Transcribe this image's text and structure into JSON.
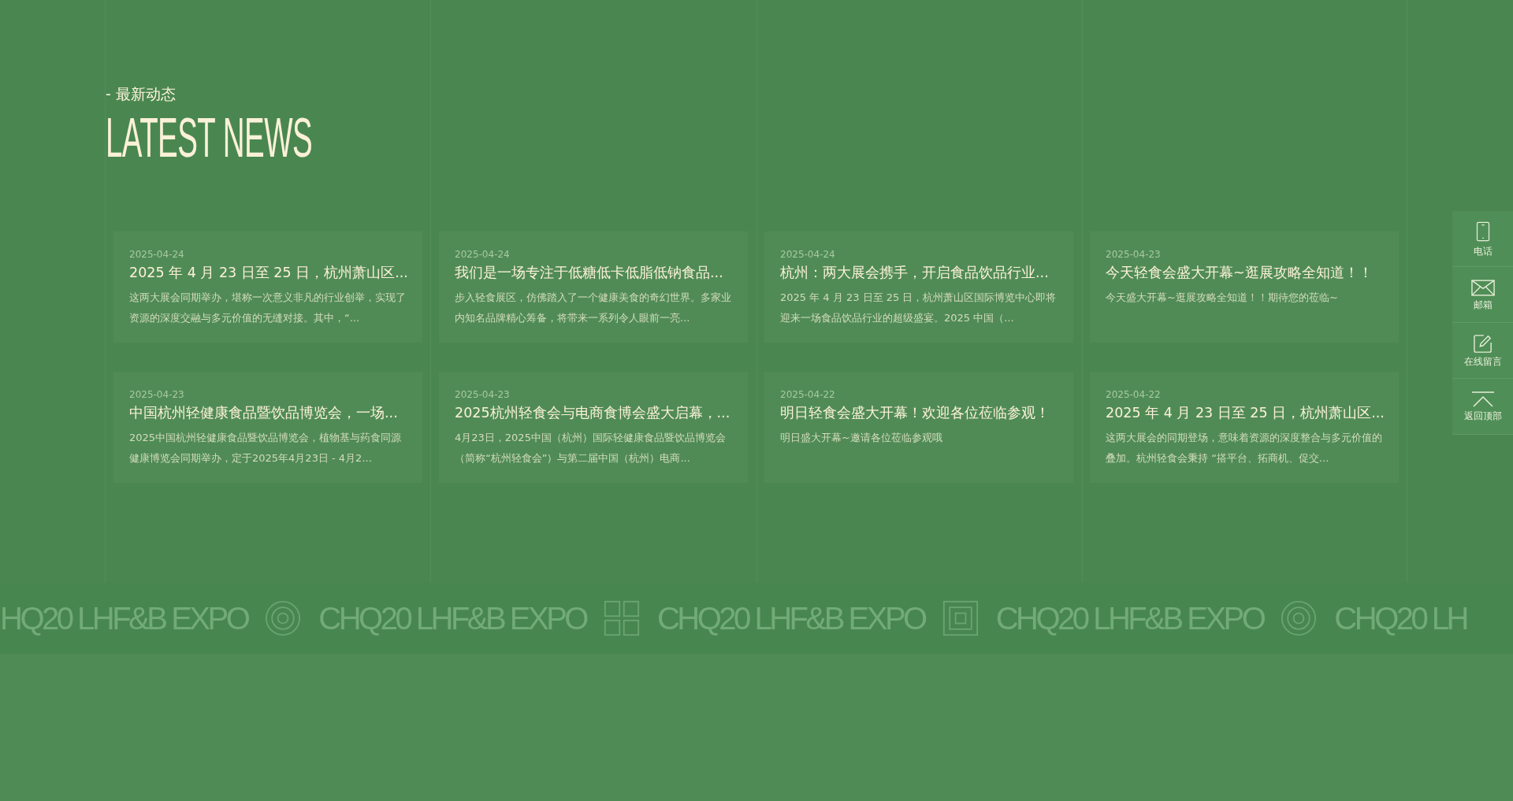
{
  "section": {
    "subtitle": "- 最新动态",
    "title": "LATEST NEWS"
  },
  "news": [
    {
      "date": "2025-04-24",
      "title": "2025 年 4 月 23 日至 25 日，杭州萧山区...",
      "summary": "这两大展会同期举办，堪称一次意义非凡的行业创举，实现了资源的深度交融与多元价值的无缝对接。其中，“..."
    },
    {
      "date": "2025-04-24",
      "title": "我们是一场专注于低糖低卡低脂低钠食品...",
      "summary": "步入轻食展区，仿佛踏入了一个健康美食的奇幻世界。多家业内知名品牌精心筹备，将带来一系列令人眼前一亮..."
    },
    {
      "date": "2025-04-24",
      "title": "杭州：两大展会携手，开启食品饮品行业...",
      "summary": "2025 年 4 月 23 日至 25 日，杭州萧山区国际博览中心即将迎来一场食品饮品行业的超级盛宴。2025 中国（..."
    },
    {
      "date": "2025-04-23",
      "title": "今天轻食会盛大开幕~逛展攻略全知道！！",
      "summary": "今天盛大开幕~逛展攻略全知道！！期待您的莅临~"
    },
    {
      "date": "2025-04-23",
      "title": "中国杭州轻健康食品暨饮品博览会，一场...",
      "summary": "2025中国杭州轻健康食品暨饮品博览会，植物基与药食同源健康博览会同期举办，定于2025年4月23日 - 4月2..."
    },
    {
      "date": "2025-04-23",
      "title": "2025杭州轻食会与电商食博会盛大启幕，...",
      "summary": "4月23日，2025中国（杭州）国际轻健康食品暨饮品博览会（简称“杭州轻食会”）与第二届中国（杭州）电商..."
    },
    {
      "date": "2025-04-22",
      "title": "明日轻食会盛大开幕！欢迎各位莅临参观！",
      "summary": "明日盛大开幕~邀请各位莅临参观哦"
    },
    {
      "date": "2025-04-22",
      "title": "2025 年 4 月 23 日至 25 日，杭州萧山区...",
      "summary": "这两大展会的同期登场，意味着资源的深度整合与多元价值的叠加。杭州轻食会秉持 “搭平台、拓商机、促交..."
    }
  ],
  "marquee": [
    {
      "kind": "text",
      "text": "HQ20 LHF&B EXPO"
    },
    {
      "kind": "rings"
    },
    {
      "kind": "text",
      "text": "CHQ20 LHF&B EXPO"
    },
    {
      "kind": "grid"
    },
    {
      "kind": "text",
      "text": "CHQ20 LHF&B EXPO"
    },
    {
      "kind": "square"
    },
    {
      "kind": "text",
      "text": "CHQ20 LHF&B EXPO"
    },
    {
      "kind": "rings"
    },
    {
      "kind": "text",
      "text": "CHQ20 LH"
    }
  ],
  "side_bar": [
    {
      "kind": "phone",
      "label": "电话"
    },
    {
      "kind": "mail",
      "label": "邮箱"
    },
    {
      "kind": "edit",
      "label": "在线留言"
    },
    {
      "kind": "top",
      "label": "返回顶部"
    }
  ]
}
